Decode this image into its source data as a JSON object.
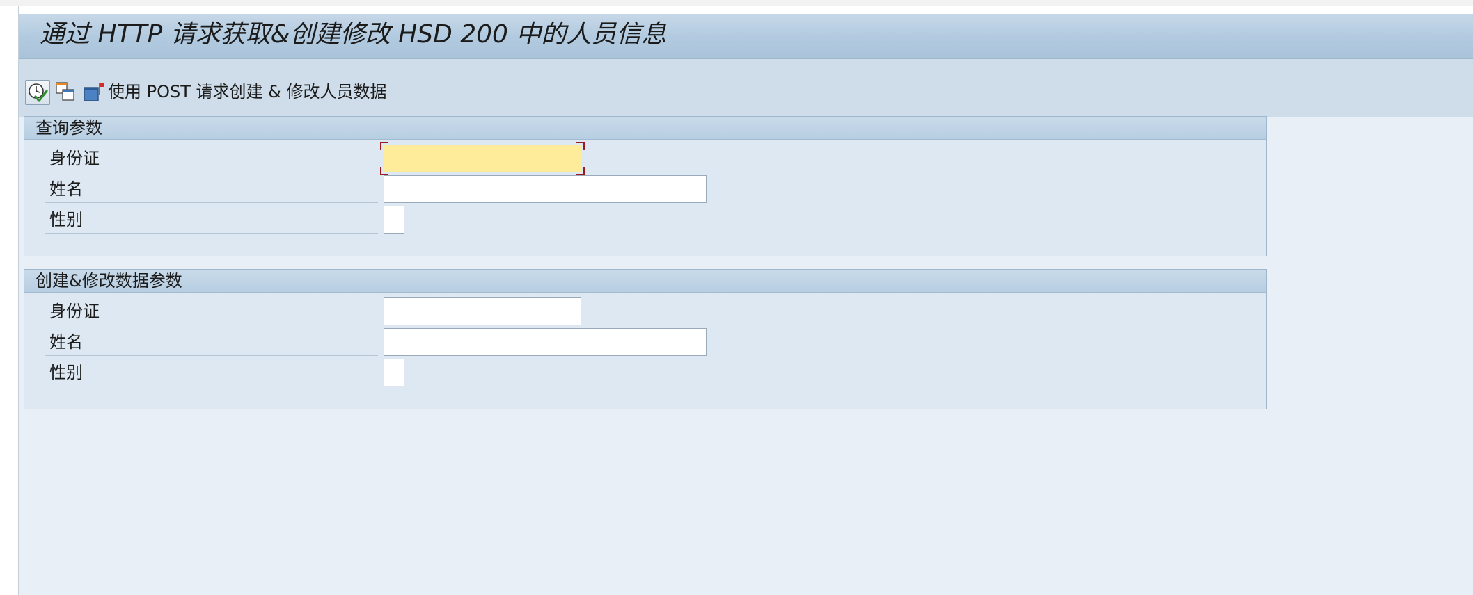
{
  "window": {
    "title": "通过 HTTP 请求获取&创建修改 HSD 200 中的人员信息"
  },
  "toolbar": {
    "execute_icon": "execute-clock-check-icon",
    "copy_icon": "copy-windows-icon",
    "window_icon": "window-flag-icon",
    "post_label": "使用 POST 请求创建 & 修改人员数据"
  },
  "query_group": {
    "title": "查询参数",
    "fields": [
      {
        "label": "身份证",
        "value": ""
      },
      {
        "label": "姓名",
        "value": ""
      },
      {
        "label": "性别",
        "value": ""
      }
    ]
  },
  "create_group": {
    "title": "创建&修改数据参数",
    "fields": [
      {
        "label": "身份证",
        "value": ""
      },
      {
        "label": "姓名",
        "value": ""
      },
      {
        "label": "性别",
        "value": ""
      }
    ]
  },
  "colors": {
    "focused_field": "#ffec9b",
    "focus_corner": "#9b1c1c",
    "background": "#e8eff6"
  }
}
